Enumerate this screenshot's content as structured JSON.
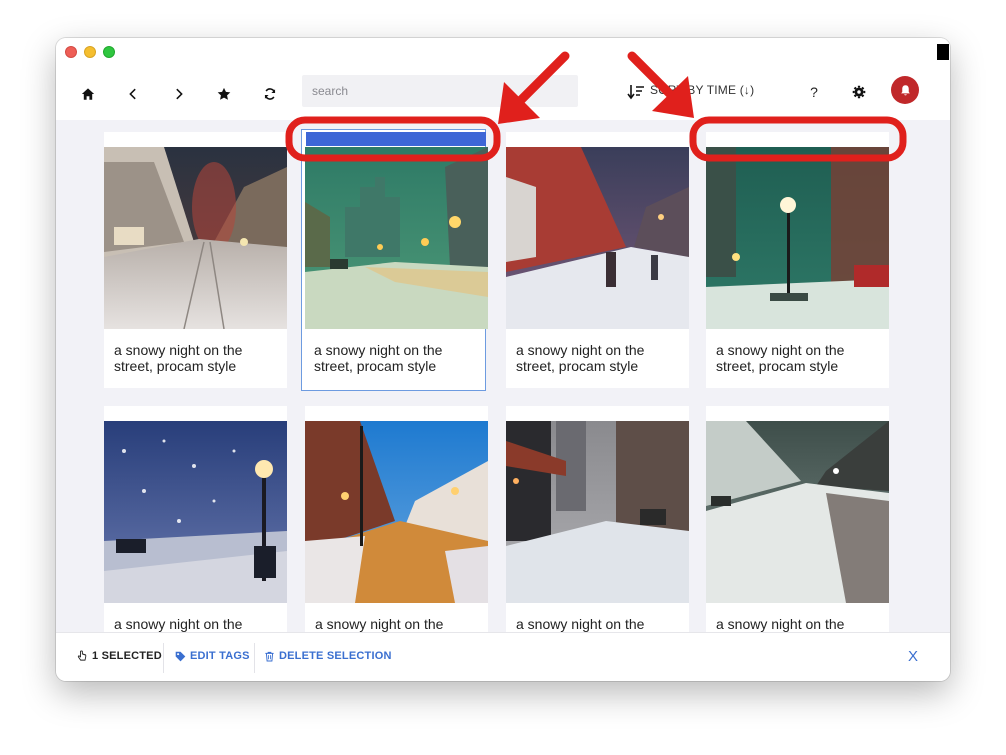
{
  "toolbar": {
    "search_placeholder": "search",
    "sort_label": "SORT BY TIME (↓)",
    "help_label": "?"
  },
  "cards": [
    {
      "caption": "a snowy night on the street, procam style",
      "selected": false
    },
    {
      "caption": "a snowy night on the street, procam style",
      "selected": true
    },
    {
      "caption": "a snowy night on the street, procam style",
      "selected": false
    },
    {
      "caption": "a snowy night on the street, procam style",
      "selected": false
    },
    {
      "caption": "a snowy night on the",
      "selected": false
    },
    {
      "caption": "a snowy night on the",
      "selected": false
    },
    {
      "caption": "a snowy night on the",
      "selected": false
    },
    {
      "caption": "a snowy night on the",
      "selected": false
    }
  ],
  "bottombar": {
    "selected_label": "1 SELECTED",
    "edit_tags_label": "EDIT TAGS",
    "delete_label": "DELETE SELECTION",
    "close_label": "X"
  },
  "colors": {
    "accent": "#3a6fd0",
    "selection_bar": "#3d66d6",
    "notification": "#c0282a",
    "annotation": "#e0201c"
  },
  "icons": [
    "home-icon",
    "chevron-left-icon",
    "chevron-right-icon",
    "star-icon",
    "refresh-icon",
    "sort-icon",
    "gear-icon",
    "bell-icon",
    "hand-pointer-icon",
    "tag-icon",
    "trash-icon"
  ]
}
